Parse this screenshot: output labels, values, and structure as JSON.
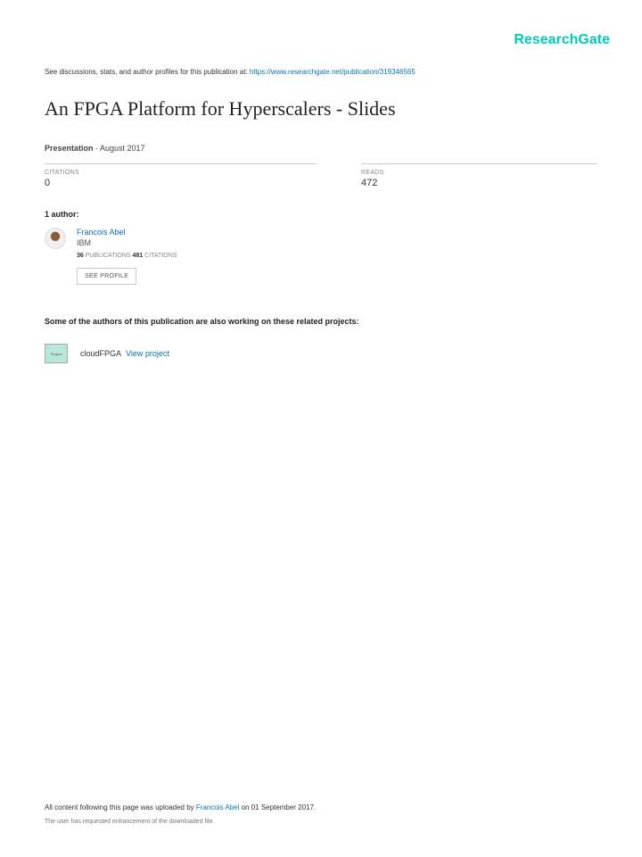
{
  "logo": "ResearchGate",
  "discussion_prefix": "See discussions, stats, and author profiles for this publication at: ",
  "discussion_link": "https://www.researchgate.net/publication/319346565",
  "title": "An FPGA Platform for Hyperscalers - Slides",
  "pub_type": "Presentation",
  "pub_date": " · August 2017",
  "citations_label": "CITATIONS",
  "citations_value": "0",
  "reads_label": "READS",
  "reads_value": "472",
  "authors_label": "1 author:",
  "author": {
    "name": "Francois Abel",
    "affiliation": "IBM",
    "pubs_count": "36",
    "pubs_label": " PUBLICATIONS   ",
    "cites_count": "481",
    "cites_label": " CITATIONS",
    "profile_btn": "SEE PROFILE"
  },
  "projects_label": "Some of the authors of this publication are also working on these related projects:",
  "project": {
    "icon_text": "Project",
    "name": "cloudFPGA ",
    "view": "View project"
  },
  "footer": {
    "prefix": "All content following this page was uploaded by ",
    "uploader": "Francois Abel",
    "suffix": " on 01 September 2017.",
    "line2": "The user has requested enhancement of the downloaded file."
  }
}
